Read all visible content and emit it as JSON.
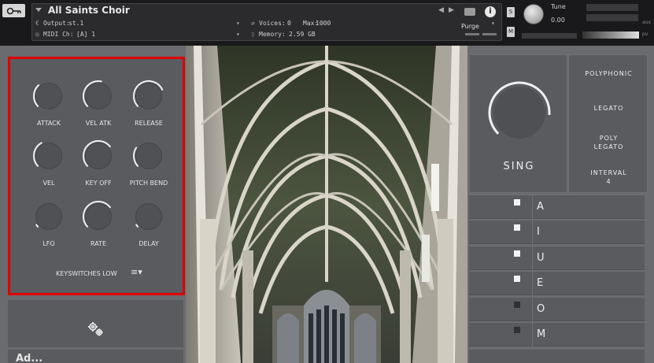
{
  "header": {
    "instrument_title": "All Saints Choir",
    "output_label": "Output:",
    "output_value": "st.1",
    "voices_label": "Voices:",
    "voices_value": "0",
    "max_label": "Max:",
    "max_value": "1000",
    "midi_label": "MIDI Ch:",
    "midi_value": "[A] 1",
    "memory_label": "Memory:",
    "memory_value": "2.59 GB",
    "purge_label": "Purge",
    "s_button": "S",
    "m_button": "M",
    "tune_label": "Tune",
    "tune_value": "0.00",
    "pan_label": "L R",
    "aux_label": "aux",
    "pv_label": "pv"
  },
  "controls": {
    "knobs": [
      {
        "label": "ATTACK",
        "level": 0.35
      },
      {
        "label": "VEL ATK",
        "level": 0.55
      },
      {
        "label": "RELEASE",
        "level": 0.75
      },
      {
        "label": "VEL",
        "level": 0.4
      },
      {
        "label": "KEY OFF",
        "level": 0.7
      },
      {
        "label": "PITCH BEND",
        "level": 0.3
      },
      {
        "label": "LFO",
        "level": 0.05
      },
      {
        "label": "RATE",
        "level": 0.7
      },
      {
        "label": "DELAY",
        "level": 0.05
      }
    ],
    "keyswitches_label": "KEYSWITCHES LOW",
    "keyswitches_icon": "menu-list-icon"
  },
  "sing": {
    "label": "SING",
    "level": 0.85
  },
  "modes": [
    {
      "label": "POLYPHONIC"
    },
    {
      "label": "LEGATO"
    },
    {
      "label": "POLY\nLEGATO"
    },
    {
      "label": "INTERVAL\n4"
    }
  ],
  "vowels": [
    {
      "letter": "A",
      "checked": true
    },
    {
      "letter": "I",
      "checked": true
    },
    {
      "letter": "U",
      "checked": true
    },
    {
      "letter": "E",
      "checked": true
    },
    {
      "letter": "O",
      "checked": false
    },
    {
      "letter": "M",
      "checked": false
    }
  ],
  "bottom": {
    "partial_text": "Ad..."
  },
  "colors": {
    "panel": "#5a5b5f",
    "highlight": "#e00000",
    "text": "#e6e6e6"
  }
}
